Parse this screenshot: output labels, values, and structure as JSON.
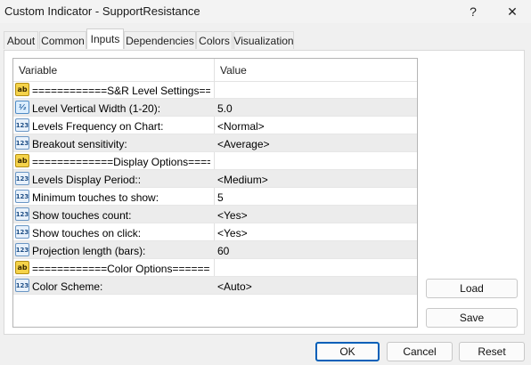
{
  "window": {
    "title": "Custom Indicator - SupportResistance",
    "help_label": "?",
    "close_label": "✕"
  },
  "tabs": [
    {
      "label": "About"
    },
    {
      "label": "Common"
    },
    {
      "label": "Inputs"
    },
    {
      "label": "Dependencies"
    },
    {
      "label": "Colors"
    },
    {
      "label": "Visualization"
    }
  ],
  "active_tab": "Inputs",
  "grid": {
    "headers": {
      "variable": "Variable",
      "value": "Value"
    },
    "rows": [
      {
        "icon": "ab",
        "variable": "============S&R Level Settings====...",
        "value": ""
      },
      {
        "icon": "v2",
        "variable": "Level Vertical Width (1-20):",
        "value": "5.0"
      },
      {
        "icon": "123",
        "variable": "Levels Frequency on Chart:",
        "value": "<Normal>"
      },
      {
        "icon": "123",
        "variable": "Breakout sensitivity:",
        "value": "<Average>"
      },
      {
        "icon": "ab",
        "variable": "=============Display Options======...",
        "value": ""
      },
      {
        "icon": "123",
        "variable": "Levels Display Period::",
        "value": "<Medium>"
      },
      {
        "icon": "123",
        "variable": "Minimum touches to show:",
        "value": "5"
      },
      {
        "icon": "123",
        "variable": "Show touches count:",
        "value": "<Yes>"
      },
      {
        "icon": "123",
        "variable": "Show touches on click:",
        "value": "<Yes>"
      },
      {
        "icon": "123",
        "variable": "Projection length (bars):",
        "value": "60"
      },
      {
        "icon": "ab",
        "variable": "============Color Options=========...",
        "value": ""
      },
      {
        "icon": "123",
        "variable": "Color Scheme:",
        "value": "<Auto>"
      }
    ]
  },
  "side_buttons": {
    "load": "Load",
    "save": "Save"
  },
  "footer_buttons": {
    "ok": "OK",
    "cancel": "Cancel",
    "reset": "Reset"
  }
}
